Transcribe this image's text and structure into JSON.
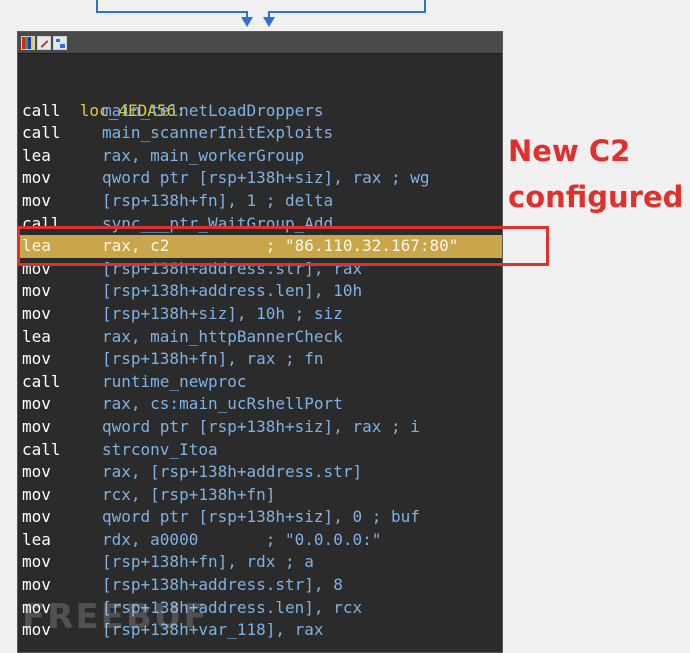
{
  "window": {
    "header_icons": [
      "color-icon",
      "edit-icon",
      "graph-icon"
    ]
  },
  "annotation": {
    "line1": "New C2",
    "line2": "configured",
    "color": "#e0302c"
  },
  "watermark": "FREEBUF",
  "code": {
    "label": "loc_4EDA56:",
    "lines": [
      {
        "mn": "call",
        "op": "main_telnetLoadDroppers"
      },
      {
        "mn": "call",
        "op": "main_scannerInitExploits"
      },
      {
        "mn": "lea",
        "op": "rax, main_workerGroup"
      },
      {
        "mn": "mov",
        "op": "qword ptr [rsp+138h+siz], rax ; wg"
      },
      {
        "mn": "mov",
        "op": "[rsp+138h+fn], 1 ; delta"
      },
      {
        "mn": "call",
        "op": "sync___ptr_WaitGroup_Add"
      },
      {
        "mn": "lea",
        "op": "rax, c2          ; \"86.110.32.167:80\""
      },
      {
        "mn": "mov",
        "op": "[rsp+138h+address.str], rax"
      },
      {
        "mn": "mov",
        "op": "[rsp+138h+address.len], 10h"
      },
      {
        "mn": "mov",
        "op": "[rsp+138h+siz], 10h ; siz"
      },
      {
        "mn": "lea",
        "op": "rax, main_httpBannerCheck"
      },
      {
        "mn": "mov",
        "op": "[rsp+138h+fn], rax ; fn"
      },
      {
        "mn": "call",
        "op": "runtime_newproc"
      },
      {
        "mn": "mov",
        "op": "rax, cs:main_ucRshellPort"
      },
      {
        "mn": "mov",
        "op": "qword ptr [rsp+138h+siz], rax ; i"
      },
      {
        "mn": "call",
        "op": "strconv_Itoa"
      },
      {
        "mn": "mov",
        "op": "rax, [rsp+138h+address.str]"
      },
      {
        "mn": "mov",
        "op": "rcx, [rsp+138h+fn]"
      },
      {
        "mn": "mov",
        "op": "qword ptr [rsp+138h+siz], 0 ; buf"
      },
      {
        "mn": "lea",
        "op": "rdx, a0000       ; \"0.0.0.0:\""
      },
      {
        "mn": "mov",
        "op": "[rsp+138h+fn], rdx ; a"
      },
      {
        "mn": "mov",
        "op": "[rsp+138h+address.str], 8"
      },
      {
        "mn": "mov",
        "op": "[rsp+138h+address.len], rcx"
      },
      {
        "mn": "mov",
        "op": "[rsp+138h+var_118], rax"
      }
    ],
    "highlight_index": 6
  }
}
